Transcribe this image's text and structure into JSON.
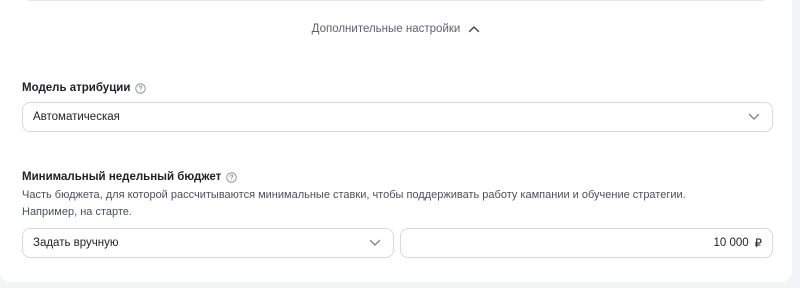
{
  "advanced": {
    "toggle_label": "Дополнительные настройки"
  },
  "attribution": {
    "label": "Модель атрибуции",
    "selected_value": "Автоматическая"
  },
  "min_budget": {
    "label": "Минимальный недельный бюджет",
    "description_line1": "Часть бюджета, для которой рассчитываются минимальные ставки, чтобы поддерживать работу кампании и обучение стратегии.",
    "description_line2": "Например, на старте.",
    "mode_value": "Задать вручную",
    "amount_value": "10 000",
    "currency": "₽"
  },
  "icons": {
    "help": "help-circle-icon",
    "chevron_up": "chevron-up-icon",
    "chevron_down": "chevron-down-icon"
  },
  "colors": {
    "border": "#d6d9e0",
    "muted_text": "#5b6271",
    "background": "#f3f4f7"
  }
}
